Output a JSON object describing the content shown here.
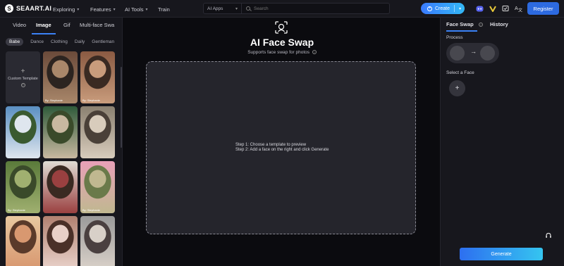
{
  "header": {
    "logo_mark": "S",
    "logo_text": "SEAART.AI",
    "nav": [
      {
        "label": "Exploring",
        "has_dropdown": true
      },
      {
        "label": "Features",
        "has_dropdown": true
      },
      {
        "label": "AI Tools",
        "has_dropdown": true
      },
      {
        "label": "Train",
        "has_dropdown": false
      }
    ],
    "search_scope": "AI Apps",
    "search_placeholder": "Search",
    "create_label": "Create",
    "register_label": "Register",
    "icons": [
      "discord-icon",
      "bolt-v-icon",
      "task-icon",
      "translate-icon"
    ]
  },
  "left_panel": {
    "tabs": [
      "Video",
      "Image",
      "Gif",
      "Multi-face Swa"
    ],
    "active_tab": "Image",
    "categories": [
      "Babe",
      "Dance",
      "Clothing",
      "Daily",
      "Gentleman"
    ],
    "active_category": "Babe",
    "custom_template": {
      "plus": "+",
      "label": "Custom Template",
      "help": "?"
    },
    "templates": [
      {
        "byline": "By: Stephanie",
        "colors": [
          "#6a4a3a",
          "#a9876a",
          "#2c2420"
        ]
      },
      {
        "byline": "By: Stephanie",
        "colors": [
          "#8a5a42",
          "#c99c7c",
          "#3a2a22"
        ]
      },
      {
        "byline": "",
        "colors": [
          "#5a8fc2",
          "#dfe6ee",
          "#3a5a30"
        ]
      },
      {
        "byline": "",
        "colors": [
          "#2f5a3a",
          "#c8b8a0",
          "#3a4a2a"
        ]
      },
      {
        "byline": "",
        "colors": [
          "#8a8070",
          "#d8ccbc",
          "#4a4038"
        ]
      },
      {
        "byline": "By: Stephanie",
        "colors": [
          "#5a7a3a",
          "#a0b070",
          "#3a4a2a"
        ]
      },
      {
        "byline": "",
        "colors": [
          "#e0dcd4",
          "#9a4040",
          "#3a2a22"
        ]
      },
      {
        "byline": "By: Stephanie",
        "colors": [
          "#e8a0b8",
          "#c0b890",
          "#6a7a4a"
        ]
      },
      {
        "byline": "",
        "colors": [
          "#e8c8a0",
          "#d89870",
          "#5a3a2a"
        ]
      },
      {
        "byline": "",
        "colors": [
          "#b08070",
          "#e8d0c8",
          "#4a3028"
        ]
      },
      {
        "byline": "",
        "colors": [
          "#9a9a9a",
          "#d8d0c8",
          "#4a4040"
        ]
      }
    ]
  },
  "main": {
    "title": "AI Face Swap",
    "subtitle": "Supports face swap for photos",
    "steps": [
      "Step 1: Choose a template to preview",
      "Step 2: Add a face on the right and click Generate"
    ]
  },
  "right_panel": {
    "tabs": [
      "Face Swap",
      "History"
    ],
    "active_tab": "Face Swap",
    "process_label": "Process",
    "select_face_label": "Select a Face",
    "add_face": "+",
    "arrow": "→",
    "generate_label": "Generate"
  },
  "colors": {
    "accent": "#3b82f6",
    "create_gradient": [
      "#3a7bff",
      "#33b8f5"
    ],
    "generate_gradient": [
      "#2d6ff0",
      "#35c5f0"
    ],
    "discord": "#5865f2",
    "bolt": "#e8c93a"
  }
}
